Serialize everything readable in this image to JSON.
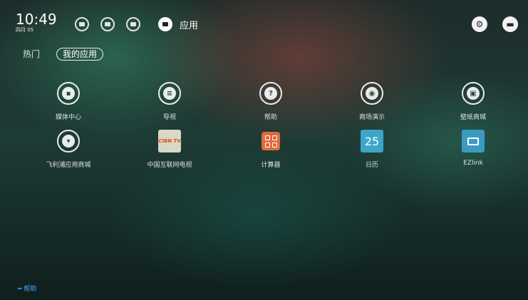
{
  "status": {
    "time": "10:49",
    "date": "四月 05"
  },
  "categories": [
    {
      "name": "video-icon"
    },
    {
      "name": "film-icon"
    },
    {
      "name": "gamepad-icon"
    },
    {
      "name": "apps-icon",
      "label": "应用",
      "active": true
    }
  ],
  "header_buttons": [
    {
      "name": "settings-icon",
      "glyph": "⚙"
    },
    {
      "name": "input-source-icon",
      "glyph": "▬"
    }
  ],
  "tabs": {
    "hot": "热门",
    "mine": "我的应用"
  },
  "apps": [
    {
      "label": "媒体中心",
      "icon": "folder-icon"
    },
    {
      "label": "导视",
      "icon": "guide-icon"
    },
    {
      "label": "帮助",
      "icon": "help-icon",
      "glyph": "?"
    },
    {
      "label": "商场演示",
      "icon": "demo-icon"
    },
    {
      "label": "壁纸商城",
      "icon": "wallpaper-icon"
    },
    {
      "label": "飞利浦应用商城",
      "icon": "shopping-cart-icon"
    },
    {
      "label": "中国互联网电视",
      "icon": "cibn-tv-icon",
      "tile_text": "CIBN TV"
    },
    {
      "label": "计算器",
      "icon": "calculator-icon"
    },
    {
      "label": "日历",
      "icon": "calendar-icon",
      "tile_text": "25"
    },
    {
      "label": "EZlink",
      "icon": "ezlink-icon"
    }
  ],
  "footer": {
    "help": "━ 帮助"
  },
  "colors": {
    "accent_blue": "#4aa8ff",
    "calc_orange": "#e06a3c",
    "tile_blue": "#3ba6c8"
  }
}
